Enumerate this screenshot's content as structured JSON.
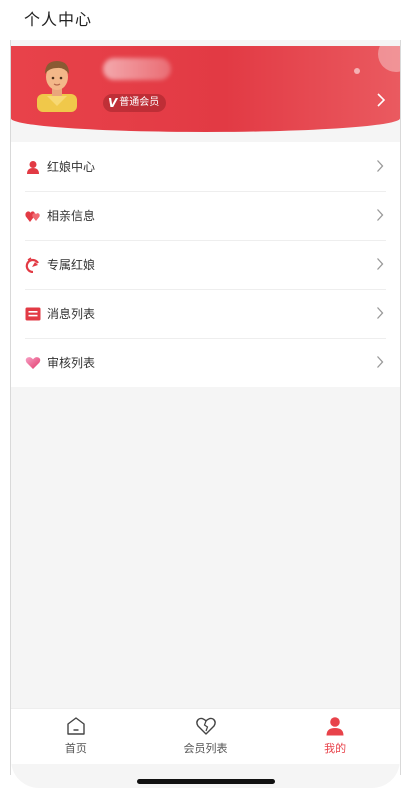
{
  "header": {
    "title": "个人中心"
  },
  "profile": {
    "member_level": "普通会员",
    "badge_prefix": "V"
  },
  "menu": {
    "items": [
      {
        "label": "红娘中心",
        "icon": "person-icon"
      },
      {
        "label": "相亲信息",
        "icon": "hearts-icon"
      },
      {
        "label": "专属红娘",
        "icon": "cupid-icon"
      },
      {
        "label": "消息列表",
        "icon": "message-icon"
      },
      {
        "label": "审核列表",
        "icon": "heart-gradient-icon"
      }
    ]
  },
  "tabbar": {
    "tabs": [
      {
        "label": "首页",
        "icon": "home-icon",
        "active": false
      },
      {
        "label": "会员列表",
        "icon": "heart-outline-icon",
        "active": false
      },
      {
        "label": "我的",
        "icon": "user-icon",
        "active": true
      }
    ]
  },
  "colors": {
    "accent": "#e8424a",
    "background": "#f5f5f5"
  }
}
